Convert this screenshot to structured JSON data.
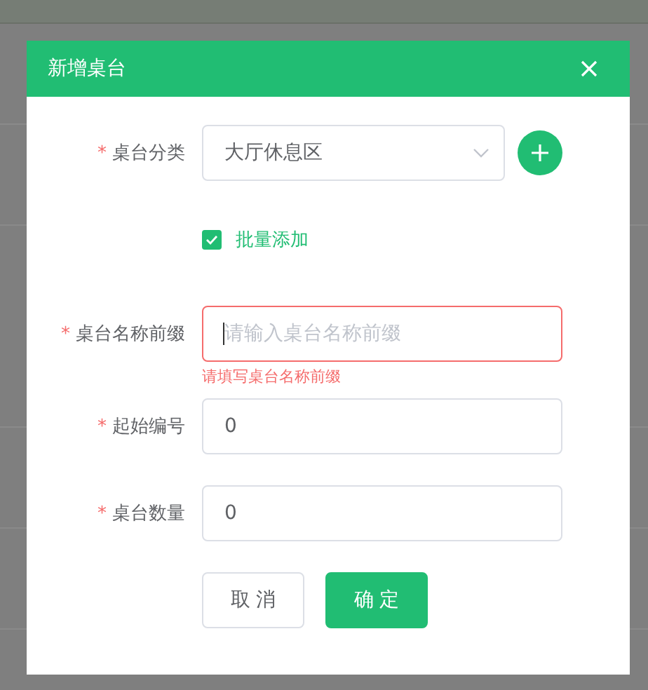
{
  "dialog": {
    "title": "新增桌台"
  },
  "fields": [
    {
      "kind": "select",
      "label": "桌台分类",
      "required_mark": "*",
      "value": "大厅休息区"
    },
    {
      "kind": "checkbox",
      "label": "批量添加",
      "checked": true
    },
    {
      "kind": "input",
      "label": "桌台名称前缀",
      "required_mark": "*",
      "placeholder": "请输入桌台名称前缀",
      "focused": true,
      "error": "请填写桌台名称前缀"
    },
    {
      "kind": "input",
      "label": "起始编号",
      "required_mark": "*",
      "value": "0",
      "focused": false
    },
    {
      "kind": "input",
      "label": "桌台数量",
      "required_mark": "*",
      "value": "0",
      "focused": false
    }
  ],
  "buttons": [
    {
      "label": "取 消",
      "primary": false
    },
    {
      "label": "确 定",
      "primary": true
    }
  ]
}
